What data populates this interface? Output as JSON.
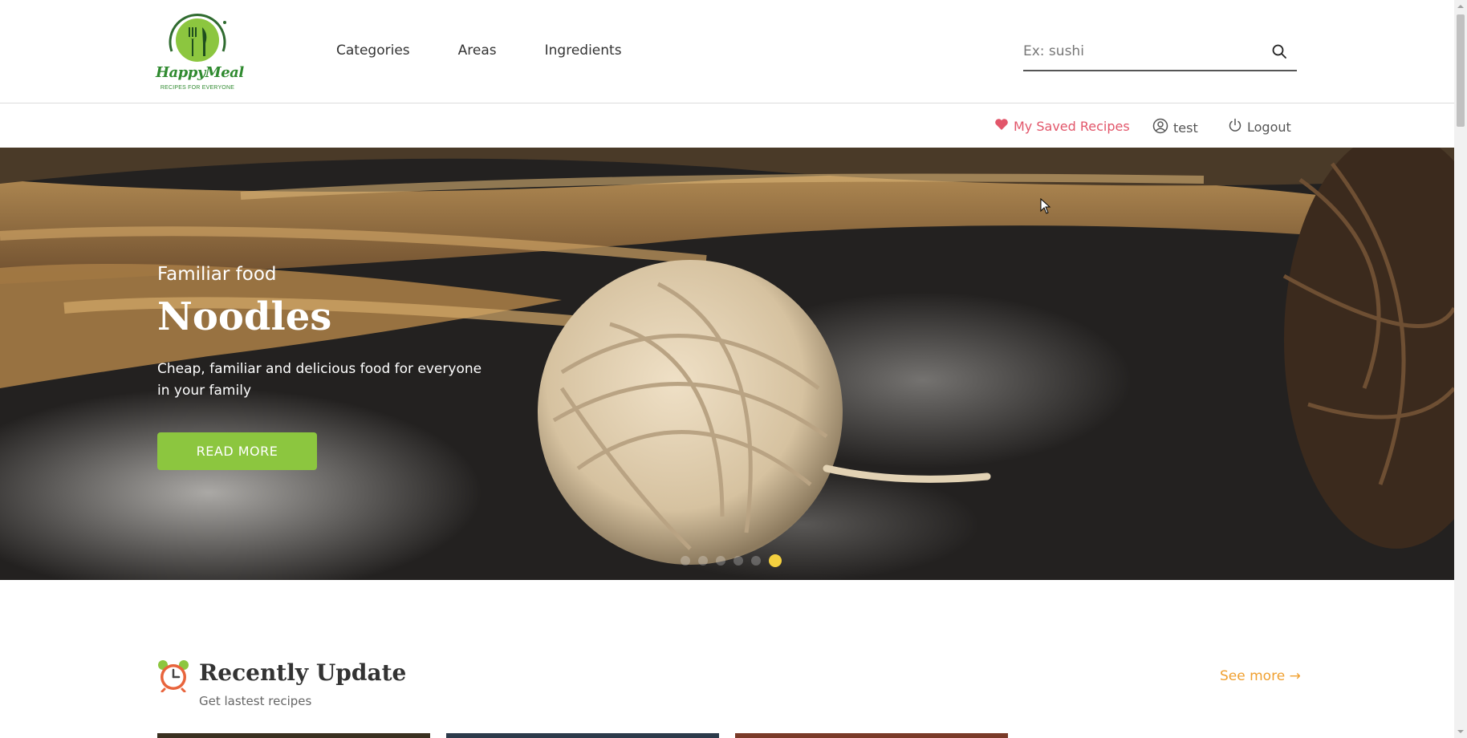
{
  "brand": {
    "name": "HappyMeal",
    "tagline": "RECIPES FOR EVERYONE",
    "primary_color": "#8cc63f",
    "brand_green": "#2f8a2f"
  },
  "nav": {
    "items": [
      {
        "label": "Categories"
      },
      {
        "label": "Areas"
      },
      {
        "label": "Ingredients"
      }
    ]
  },
  "search": {
    "placeholder": "Ex: sushi",
    "icon": "search-icon"
  },
  "account": {
    "saved_label": "My Saved Recipes",
    "saved_icon": "heart-icon",
    "saved_color": "#e2566a",
    "username": "test",
    "user_icon": "user-circle-icon",
    "logout_label": "Logout",
    "logout_icon": "power-icon"
  },
  "hero": {
    "kicker": "Familiar food",
    "title": "Noodles",
    "description": "Cheap, familiar and delicious food for everyone in your family",
    "button_label": "READ MORE",
    "slide_count": 6,
    "active_slide": 6,
    "active_dot_color": "#f4d03f"
  },
  "recent": {
    "icon": "alarm-clock-icon",
    "title": "Recently Update",
    "subtitle": "Get lastest recipes",
    "see_more_label": "See more",
    "see_more_color": "#f0a030"
  }
}
